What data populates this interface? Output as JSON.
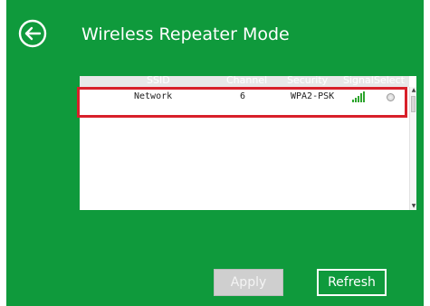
{
  "header": {
    "title": "Wireless Repeater Mode",
    "back_icon": "arrow-left-circle-icon"
  },
  "table": {
    "columns": [
      "SSID",
      "Channel",
      "Security",
      "Signal",
      "Select"
    ],
    "rows": [
      {
        "ssid": "Network",
        "channel": "6",
        "security": "WPA2-PSK",
        "signal_icon": "signal-strength-icon",
        "selected": false
      }
    ]
  },
  "buttons": {
    "apply": "Apply",
    "refresh": "Refresh"
  },
  "colors": {
    "panel_background": "#0f9a3c",
    "highlight_border": "#d8202a",
    "signal_bars": "#2ea52e"
  }
}
